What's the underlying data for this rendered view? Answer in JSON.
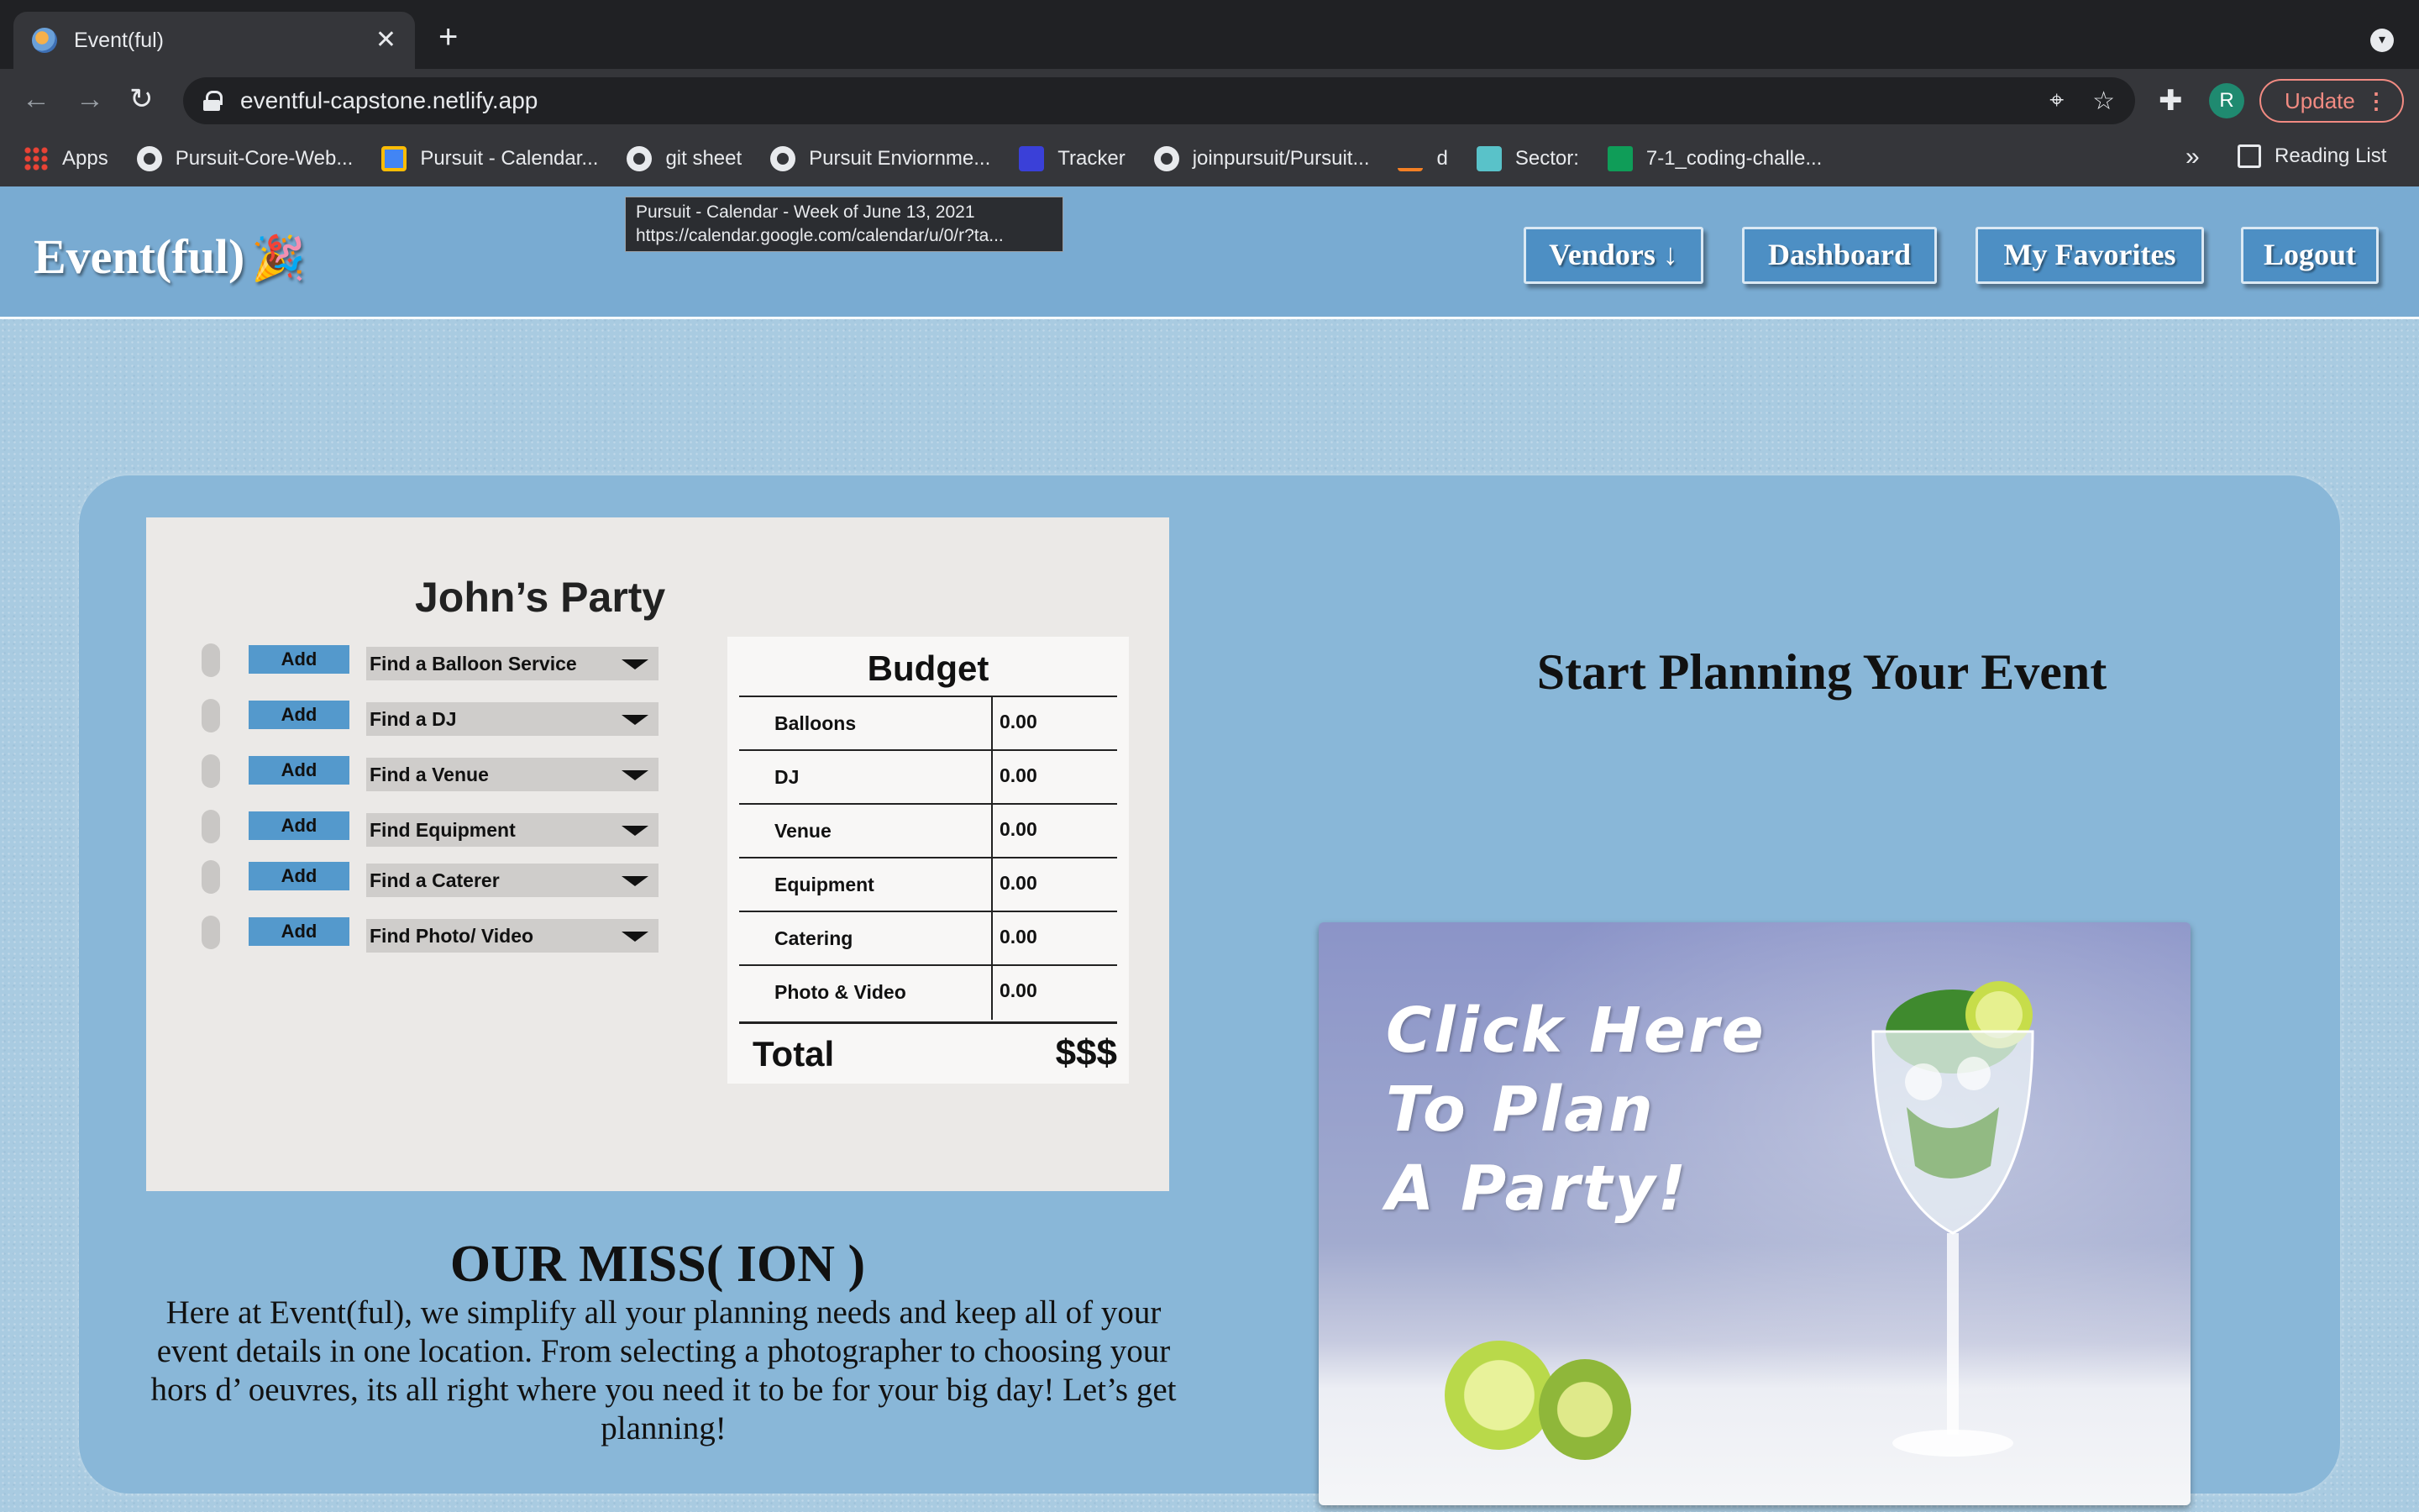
{
  "browser": {
    "tab_title": "Event(ful)",
    "tab_close": "✕",
    "new_tab": "+",
    "url": "eventful-capstone.netlify.app",
    "profile_initial": "R",
    "update_label": "Update",
    "bookmarks_more": "»",
    "reading_list": "Reading List",
    "bookmarks": [
      {
        "label": "Apps",
        "icon": "apps-grid-icon"
      },
      {
        "label": "Pursuit-Core-Web...",
        "icon": "github-icon"
      },
      {
        "label": "Pursuit - Calendar...",
        "icon": "calendar-icon"
      },
      {
        "label": "git sheet",
        "icon": "github-icon"
      },
      {
        "label": "Pursuit Enviornme...",
        "icon": "github-icon"
      },
      {
        "label": "Tracker",
        "icon": "tracker-icon"
      },
      {
        "label": "joinpursuit/Pursuit...",
        "icon": "github-icon"
      },
      {
        "label": "d",
        "icon": "stackoverflow-icon"
      },
      {
        "label": "Sector:",
        "icon": "sector-icon"
      },
      {
        "label": "7-1_coding-challe...",
        "icon": "sheets-icon"
      }
    ]
  },
  "tooltip": {
    "line1": "Pursuit - Calendar - Week of June 13, 2021",
    "line2": "https://calendar.google.com/calendar/u/0/r?ta..."
  },
  "navbar": {
    "logo": "Event(ful)",
    "logo_emoji": "🎉",
    "vendors": "Vendors ↓",
    "dashboard": "Dashboard",
    "favorites": "My Favorites",
    "logout": "Logout"
  },
  "planner": {
    "title": "John’s Party",
    "add_label": "Add",
    "rows": [
      "Find a Balloon Service",
      "Find a DJ",
      "Find a Venue",
      "Find Equipment",
      "Find a Caterer",
      "Find Photo/ Video"
    ],
    "budget": {
      "title": "Budget",
      "items": [
        {
          "category": "Balloons",
          "value": "0.00"
        },
        {
          "category": "DJ",
          "value": "0.00"
        },
        {
          "category": "Venue",
          "value": "0.00"
        },
        {
          "category": "Equipment",
          "value": "0.00"
        },
        {
          "category": "Catering",
          "value": "0.00"
        },
        {
          "category": "Photo & Video",
          "value": "0.00"
        }
      ],
      "total_label": "Total",
      "total_value": "$$$"
    }
  },
  "mission": {
    "title": "OUR MISS( ION )",
    "text": "Here at Event(ful), we simplify all your planning needs and keep all of your event details in one location. From selecting a photographer to choosing your hors d’ oeuvres, its all right where you need it to be for your big day! Let’s get planning!"
  },
  "plan": {
    "title": "Start Planning Your Event",
    "promo_lines": [
      "Click Here",
      "To Plan",
      "A  Party!"
    ]
  }
}
